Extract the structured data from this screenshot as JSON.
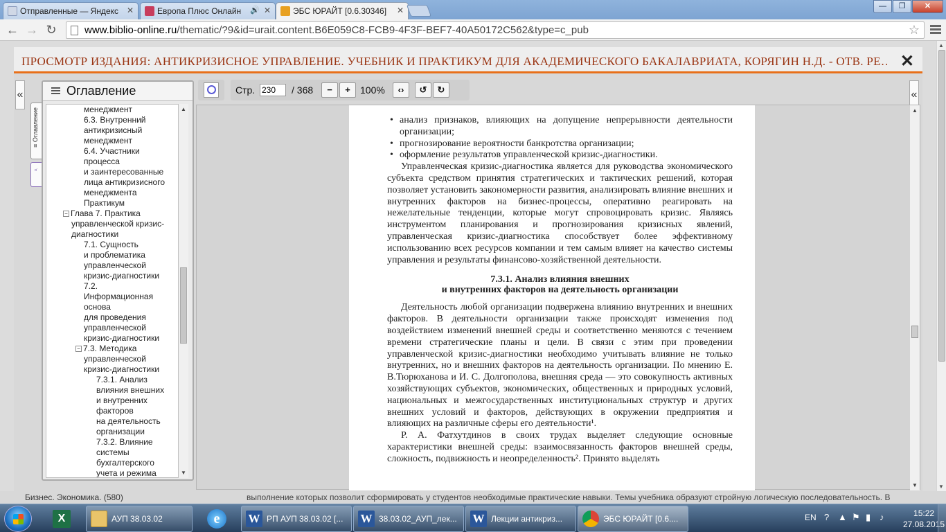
{
  "browser": {
    "tabs": [
      {
        "label": "Отправленные — Яндекс",
        "favicon_color": "#d0d8e6"
      },
      {
        "label": "Европа Плюс Онлайн",
        "favicon_color": "#c73c5c",
        "audio": "🔊"
      },
      {
        "label": "ЭБС ЮРАЙТ [0.6.30346]",
        "favicon_color": "#e8a020"
      }
    ],
    "close_glyph": "✕",
    "window": {
      "minimize": "—",
      "maximize": "❐",
      "close": "✕"
    },
    "url_host": "www.biblio-online.ru",
    "url_path": "/thematic/?9&id=urait.content.B6E059C8-FCB9-4F3F-BEF7-40A50172C562&type=c_pub",
    "nav": {
      "back": "←",
      "forward": "→",
      "reload": "↻"
    },
    "star": "☆"
  },
  "viewer": {
    "title": "ПРОСМОТР ИЗДАНИЯ: АНТИКРИЗИСНОЕ УПРАВЛЕНИЕ. УЧЕБНИК И ПРАКТИКУМ ДЛЯ АКАДЕМИЧЕСКОГО БАКАЛАВРИАТА, КОРЯГИН Н.Д. - ОТВ. РЕ…",
    "close": "✕",
    "collapse_left": "«",
    "collapse_right": "«",
    "toc_tab_label": "≡ Оглавление",
    "search_tab_label": "⌕",
    "accent_color": "#e8701a"
  },
  "toc": {
    "title": "Оглавление",
    "items": [
      {
        "text": "менеджмент",
        "level": 1
      },
      {
        "text": "6.3. Внутренний",
        "level": 1
      },
      {
        "text": "антикризисный",
        "level": 1
      },
      {
        "text": "менеджмент",
        "level": 1
      },
      {
        "text": "6.4. Участники",
        "level": 1
      },
      {
        "text": "процесса",
        "level": 1
      },
      {
        "text": "и заинтересованные",
        "level": 1
      },
      {
        "text": "лица антикризисного",
        "level": 1
      },
      {
        "text": "менеджмента",
        "level": 1
      },
      {
        "text": "Практикум",
        "level": 1
      },
      {
        "text": "Глава 7. Практика",
        "level": 0,
        "toggle": "−"
      },
      {
        "text": "управленческой кризис-",
        "level": 0
      },
      {
        "text": "диагностики",
        "level": 0
      },
      {
        "text": "7.1. Сущность",
        "level": 1
      },
      {
        "text": "и проблематика",
        "level": 1
      },
      {
        "text": "управленческой",
        "level": 1
      },
      {
        "text": "кризис-диагностики",
        "level": 1
      },
      {
        "text": "7.2.",
        "level": 1
      },
      {
        "text": "Информационная",
        "level": 1
      },
      {
        "text": "основа",
        "level": 1
      },
      {
        "text": "для проведения",
        "level": 1
      },
      {
        "text": "управленческой",
        "level": 1
      },
      {
        "text": "кризис-диагностики",
        "level": 1
      },
      {
        "text": "7.3. Методика",
        "level": 1,
        "toggle": "−"
      },
      {
        "text": "управленческой",
        "level": 1
      },
      {
        "text": "кризис-диагностики",
        "level": 1
      },
      {
        "text": "7.3.1. Анализ",
        "level": 2
      },
      {
        "text": "влияния внешних",
        "level": 2
      },
      {
        "text": "и внутренних",
        "level": 2
      },
      {
        "text": "факторов",
        "level": 2
      },
      {
        "text": "на деятельность",
        "level": 2
      },
      {
        "text": "организации",
        "level": 2
      },
      {
        "text": "7.3.2. Влияние",
        "level": 2
      },
      {
        "text": "системы",
        "level": 2
      },
      {
        "text": "бухгалтерского",
        "level": 2
      },
      {
        "text": "учета и режима",
        "level": 2
      }
    ]
  },
  "toolbar": {
    "page_label": "Стр.",
    "page_value": "230",
    "page_total": "/ 368",
    "zoom_out": "−",
    "zoom_in": "+",
    "zoom": "100%",
    "fit": "‹›",
    "rotate_left": "↺",
    "rotate_right": "↻"
  },
  "document": {
    "bullets_top": [
      "анализ признаков, влияющих на допущение непрерывности деятельности организации;",
      "прогнозирование вероятности банкротства организации;",
      "оформление результатов управленческой кризис-диагностики."
    ],
    "para1": "Управленческая кризис-диагностика является для руководства экономического субъекта средством принятия стратегических и тактических решений, которая позволяет установить закономерности развития, анализировать влияние внешних и внутренних факторов на бизнес-процессы, оперативно реагировать на нежелательные тенденции, которые могут спровоцировать кризис. Являясь инструментом планирования и прогнозирования кризисных явлений, управленческая кризис-диагностика способствует более эффективному использованию всех ресурсов компании и тем самым влияет на качество системы управления и результаты финансово-хозяйственной деятельности.",
    "heading_line1": "7.3.1. Анализ влияния внешних",
    "heading_line2": "и внутренних факторов на деятельность организации",
    "para2": "Деятельность любой организации подвержена влиянию внутренних и внешних факторов. В деятельности организации также происходят изменения под воздействием изменений внешней среды и соответственно меняются с течением времени стратегические планы и цели. В связи с этим при проведении управленческой кризис-диагностики необходимо учитывать влияние не только внутренних, но и внешних факторов на деятельность организации. По мнению Е. В.Тюрюханова и И. С. Долгополова, внешняя среда — это совокупность активных хозяйствующих субъектов, экономических, общественных и природных условий, национальных и межгосударственных институциональных структур и других внешних условий и факторов, действующих в окружении предприятия и влияющих на различные сферы его деятельности¹.",
    "para3": "Р. А. Фатхутдинов в своих трудах выделяет следующие основные характеристики внешней среды: взаимосвязанность факторов внешней среды, сложность, подвижность и неопределенность². Принято выделять"
  },
  "background_page": {
    "left_text": "Бизнес. Экономика. (580)",
    "right_text": "выполнение которых позволит сформировать у студентов необходимые практические навыки. Темы учебника образуют стройную логическую последовательность. В"
  },
  "taskbar": {
    "items": [
      {
        "label": "АУП 38.03.02",
        "icon": "folder"
      },
      {
        "label": "РП АУП 38.03.02 [...",
        "icon": "word"
      },
      {
        "label": "38.03.02_АУП_лек...",
        "icon": "word"
      },
      {
        "label": "Лекции антикриз...",
        "icon": "word"
      },
      {
        "label": "ЭБС ЮРАЙТ [0.6....",
        "icon": "chrome"
      }
    ],
    "lang": "EN",
    "time": "15:22",
    "date": "27.08.2015"
  }
}
